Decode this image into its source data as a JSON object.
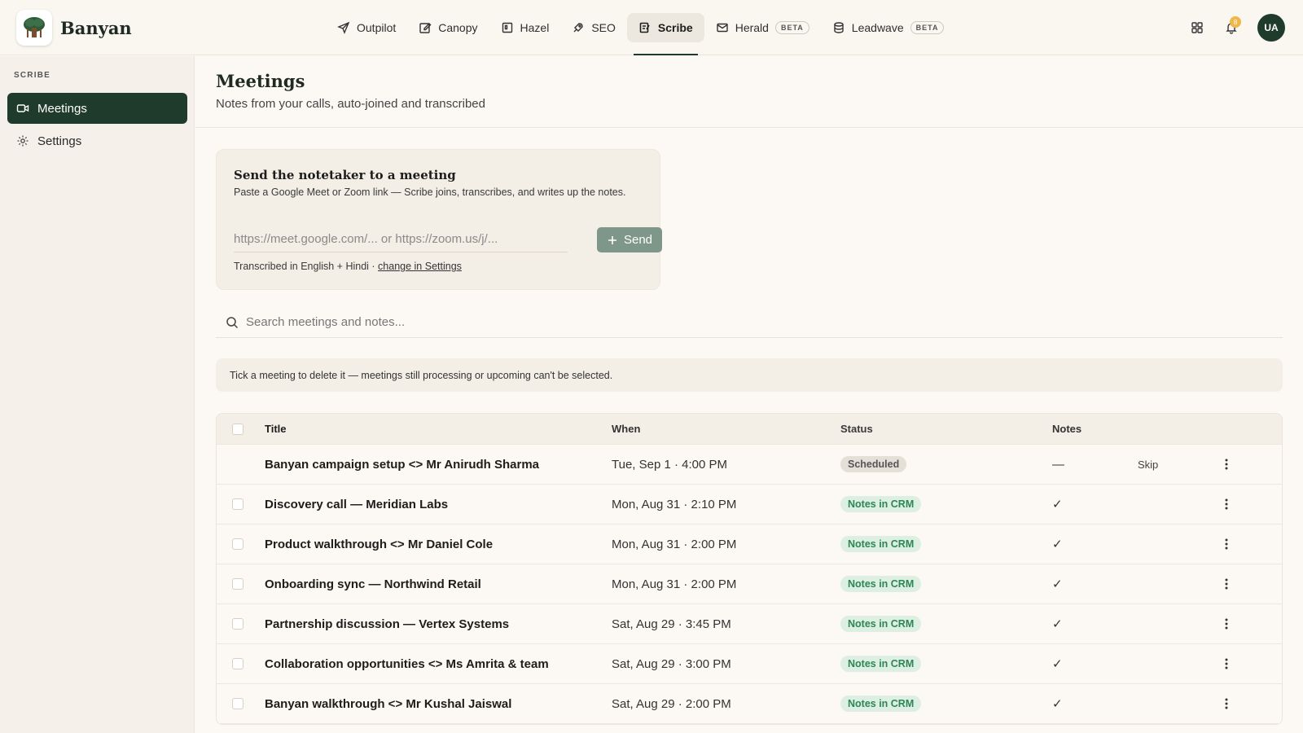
{
  "brand": {
    "name": "Banyan"
  },
  "nav": [
    {
      "label": "Outpilot",
      "icon": "send-icon"
    },
    {
      "label": "Canopy",
      "icon": "edit-icon"
    },
    {
      "label": "Hazel",
      "icon": "frame-icon"
    },
    {
      "label": "SEO",
      "icon": "rocket-icon"
    },
    {
      "label": "Scribe",
      "icon": "note-icon",
      "active": true
    },
    {
      "label": "Herald",
      "icon": "mail-icon",
      "badge": "BETA"
    },
    {
      "label": "Leadwave",
      "icon": "database-icon",
      "badge": "BETA"
    }
  ],
  "top_right": {
    "notification_count": "8",
    "avatar_initials": "UA"
  },
  "sidebar": {
    "heading": "SCRIBE",
    "items": [
      {
        "label": "Meetings",
        "icon": "video-icon",
        "active": true
      },
      {
        "label": "Settings",
        "icon": "gear-icon"
      }
    ]
  },
  "page": {
    "title": "Meetings",
    "subtitle": "Notes from your calls, auto-joined and transcribed"
  },
  "notetaker": {
    "title": "Send the notetaker to a meeting",
    "description": "Paste a Google Meet or Zoom link — Scribe joins, transcribes, and writes up the notes.",
    "input_placeholder": "https://meet.google.com/... or https://zoom.us/j/...",
    "send_label": "Send",
    "language_note": "Transcribed in English + Hindi · ",
    "language_link": "change in Settings"
  },
  "search": {
    "placeholder": "Search meetings and notes..."
  },
  "hint": "Tick a meeting to delete it — meetings still processing or upcoming can't be selected.",
  "table": {
    "headers": {
      "title": "Title",
      "when": "When",
      "status": "Status",
      "notes": "Notes"
    },
    "rows": [
      {
        "title": "Banyan campaign setup <> Mr Anirudh Sharma",
        "when": "Tue, Sep 1 · 4:00 PM",
        "status": "Scheduled",
        "status_type": "scheduled",
        "notes": "—",
        "action": "Skip",
        "selectable": false
      },
      {
        "title": "Discovery call — Meridian Labs",
        "when": "Mon, Aug 31 · 2:10 PM",
        "status": "Notes in CRM",
        "status_type": "crm",
        "notes": "✓",
        "action": "",
        "selectable": true
      },
      {
        "title": "Product walkthrough <> Mr Daniel Cole",
        "when": "Mon, Aug 31 · 2:00 PM",
        "status": "Notes in CRM",
        "status_type": "crm",
        "notes": "✓",
        "action": "",
        "selectable": true
      },
      {
        "title": "Onboarding sync — Northwind Retail",
        "when": "Mon, Aug 31 · 2:00 PM",
        "status": "Notes in CRM",
        "status_type": "crm",
        "notes": "✓",
        "action": "",
        "selectable": true
      },
      {
        "title": "Partnership discussion — Vertex Systems",
        "when": "Sat, Aug 29 · 3:45 PM",
        "status": "Notes in CRM",
        "status_type": "crm",
        "notes": "✓",
        "action": "",
        "selectable": true
      },
      {
        "title": "Collaboration opportunities <> Ms Amrita & team",
        "when": "Sat, Aug 29 · 3:00 PM",
        "status": "Notes in CRM",
        "status_type": "crm",
        "notes": "✓",
        "action": "",
        "selectable": true
      },
      {
        "title": "Banyan walkthrough <> Mr Kushal Jaiswal",
        "when": "Sat, Aug 29 · 2:00 PM",
        "status": "Notes in CRM",
        "status_type": "crm",
        "notes": "✓",
        "action": "",
        "selectable": true
      }
    ]
  },
  "colors": {
    "accent": "#1f3b2c",
    "crm_badge_bg": "#dcefe2",
    "crm_badge_text": "#2d8653",
    "send_button": "#7f968a"
  }
}
